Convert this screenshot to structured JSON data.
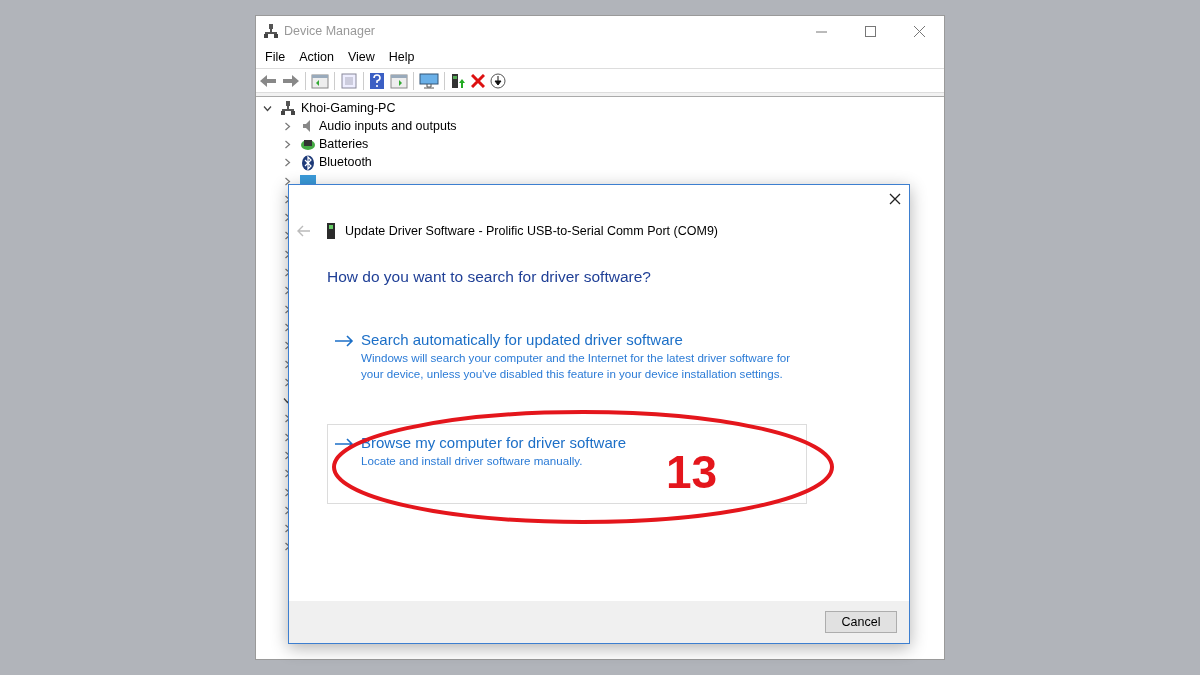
{
  "window": {
    "title": "Device Manager"
  },
  "menu": [
    "File",
    "Action",
    "View",
    "Help"
  ],
  "tree": {
    "label": "Khoi-Gaming-PC",
    "expanded": true,
    "children": [
      {
        "label": "Audio inputs and outputs",
        "expanded": false
      },
      {
        "label": "Batteries",
        "expanded": false
      },
      {
        "label": "Bluetooth",
        "expanded": false
      },
      {
        "expanded": false
      }
    ]
  },
  "covered_rows": [
    {
      "expanded": false
    },
    {
      "expanded": false
    },
    {
      "expanded": false
    },
    {
      "expanded": false
    },
    {
      "expanded": false
    },
    {
      "expanded": false
    },
    {
      "expanded": false
    },
    {
      "expanded": false
    },
    {
      "expanded": false
    },
    {
      "expanded": false
    },
    {
      "expanded": false
    },
    {
      "expanded": true
    },
    {
      "expanded": false
    },
    {
      "expanded": false
    },
    {
      "expanded": false
    },
    {
      "expanded": false
    },
    {
      "expanded": false
    },
    {
      "expanded": false
    },
    {
      "expanded": false
    },
    {
      "expanded": false
    }
  ],
  "dialog": {
    "title": "Update Driver Software - Prolific USB-to-Serial Comm Port (COM9)",
    "heading": "How do you want to search for driver software?",
    "options": [
      {
        "title": "Search automatically for updated driver software",
        "description": "Windows will search your computer and the Internet for the latest driver software for your device, unless you've disabled this feature in your device installation settings.",
        "selected": false
      },
      {
        "title": "Browse my computer for driver software",
        "description": "Locate and install driver software manually.",
        "selected": true
      }
    ],
    "buttons": [
      "Cancel"
    ]
  },
  "annotation": {
    "label": "13"
  }
}
